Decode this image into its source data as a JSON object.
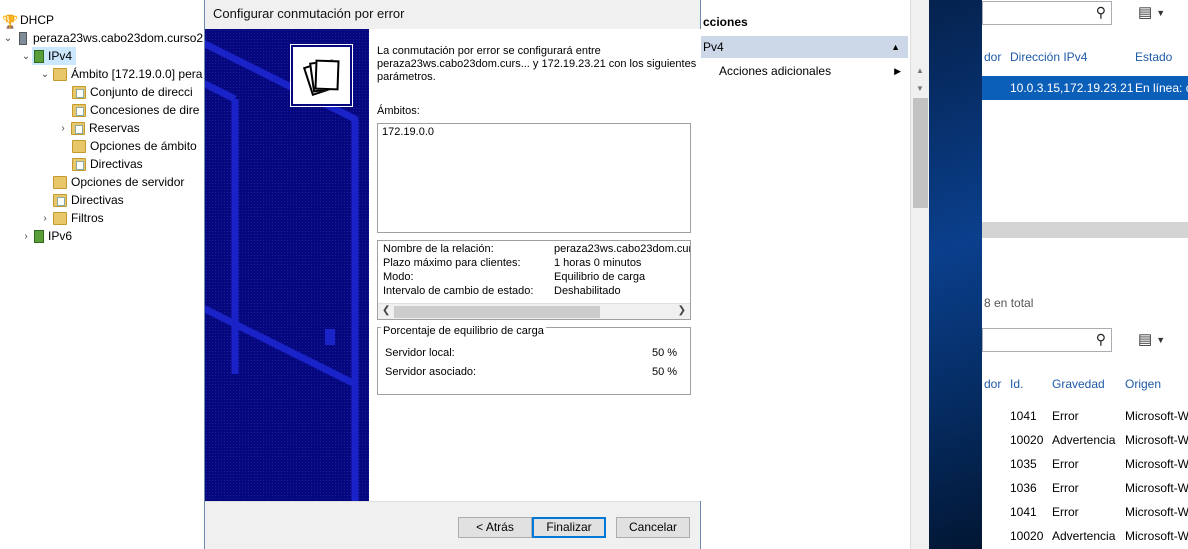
{
  "tree": {
    "root": "DHCP",
    "server": "peraza23ws.cabo23dom.curso2",
    "ipv4": "IPv4",
    "scope": "Ámbito [172.19.0.0] pera",
    "pool": "Conjunto de direcci",
    "leases": "Concesiones de dire",
    "reservations": "Reservas",
    "scope_options": "Opciones de ámbito",
    "scope_policies": "Directivas",
    "server_options": "Opciones de servidor",
    "policies": "Directivas",
    "filters": "Filtros",
    "ipv6": "IPv6"
  },
  "actions": {
    "header": "cciones",
    "ipv4": "Pv4",
    "more": "Acciones adicionales"
  },
  "dialog": {
    "title": "Configurar conmutación por error",
    "intro": "La conmutación por error se configurará entre peraza23ws.cabo23dom.curs... y 172.19.23.21 con los siguientes parámetros.",
    "scopes_label": "Ámbitos:",
    "scopes": [
      "172.19.0.0"
    ],
    "properties": [
      {
        "key": "Nombre de la relación:",
        "value": "peraza23ws.cabo23dom.curs"
      },
      {
        "key": "Plazo máximo para clientes:",
        "value": "1 horas 0 minutos"
      },
      {
        "key": "Modo:",
        "value": "Equilibrio de carga"
      },
      {
        "key": "Intervalo de cambio de estado:",
        "value": "Deshabilitado"
      }
    ],
    "balance_group_label": "Porcentaje de equilibrio de carga",
    "local_server_label": "Servidor local:",
    "local_server_value": "50 %",
    "partner_server_label": "Servidor asociado:",
    "partner_server_value": "50 %",
    "buttons": {
      "back": "< Atrás",
      "finish": "Finalizar",
      "cancel": "Cancelar"
    }
  },
  "servers_panel": {
    "columns": [
      "dor",
      "Dirección IPv4",
      "Estado"
    ],
    "selected_row": {
      "address": "10.0.3.15,172.19.23.21",
      "status": "En línea: c"
    },
    "total": "8 en total"
  },
  "events_panel": {
    "columns": [
      "dor",
      "Id.",
      "Gravedad",
      "Origen"
    ],
    "rows": [
      {
        "id": "1041",
        "severity": "Error",
        "source": "Microsoft-W"
      },
      {
        "id": "10020",
        "severity": "Advertencia",
        "source": "Microsoft-W"
      },
      {
        "id": "1035",
        "severity": "Error",
        "source": "Microsoft-W"
      },
      {
        "id": "1036",
        "severity": "Error",
        "source": "Microsoft-W"
      },
      {
        "id": "1041",
        "severity": "Error",
        "source": "Microsoft-W"
      },
      {
        "id": "10020",
        "severity": "Advertencia",
        "source": "Microsoft-W"
      }
    ]
  },
  "colors": {
    "accent": "#0b5fb8",
    "wizard_art": "#05077f",
    "selection": "#cce8ff",
    "action_highlight": "#ccd8e8"
  },
  "icons": {
    "search": "magnifier-icon",
    "view": "list-view-icon",
    "dropdown": "chevron-down-icon"
  }
}
